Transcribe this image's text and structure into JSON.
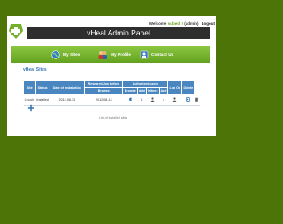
{
  "header": {
    "welcome_prefix": "Welcome",
    "welcome_name": "subedi !",
    "welcome_role": "(admin)",
    "logout": "Logout",
    "title": "vHeal Admin Panel"
  },
  "nav": [
    {
      "label": "My Sites",
      "icon": "globe-icon"
    },
    {
      "label": "My Profile",
      "icon": "users-icon"
    },
    {
      "label": "Contact Us",
      "icon": "contact-icon"
    }
  ],
  "section_title": "vHeal Sites",
  "table": {
    "headers_top": [
      "Site",
      "Status",
      "Date of Installation",
      "Research Jos before",
      "Authorized users",
      "Log On",
      "Delete"
    ],
    "headers_sub": [
      "Browse",
      "Browse",
      "Add",
      "Others",
      "Add"
    ],
    "rows": [
      {
        "site": "Lincoln",
        "status": "Installed",
        "date": "2012-08-13",
        "research": "2012-08-13",
        "count1": "1",
        "count2": "4"
      }
    ]
  },
  "list_link": "List of installed sites",
  "colors": {
    "background": "#4c7406",
    "accent": "#6aa01e",
    "header": "#4a87c0"
  }
}
